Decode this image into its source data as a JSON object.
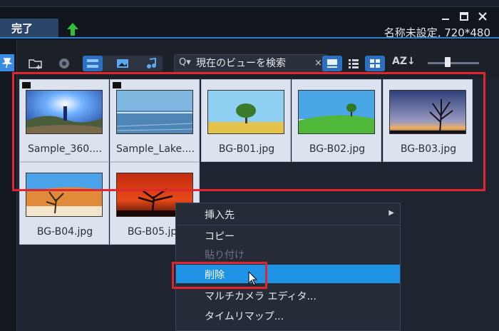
{
  "window": {
    "done_label": "完了",
    "project_info": "名称未設定, 720*480",
    "minimize_glyph": "—",
    "maximize_glyph": "■",
    "close_glyph": "✕"
  },
  "toolbar": {
    "search_placeholder": "現在のビューを検索",
    "search_icon": "Q▾",
    "clear_glyph": "×",
    "sort_label": "AZ↓",
    "view_buttons": [
      "grid-large-view",
      "list-view",
      "grid-small-view"
    ],
    "media_filters": [
      "video-filter",
      "image-filter",
      "audio-filter"
    ]
  },
  "library": {
    "items": [
      {
        "name": "Sample_360....",
        "type": "video"
      },
      {
        "name": "Sample_Lake....",
        "type": "video"
      },
      {
        "name": "BG-B01.jpg",
        "type": "image"
      },
      {
        "name": "BG-B02.jpg",
        "type": "image"
      },
      {
        "name": "BG-B03.jpg",
        "type": "image"
      },
      {
        "name": "BG-B04.jpg",
        "type": "image"
      },
      {
        "name": "BG-B05.jpg",
        "type": "image"
      }
    ]
  },
  "context_menu": {
    "items": [
      {
        "label": "挿入先",
        "submenu": true,
        "enabled": true
      },
      {
        "label": "コピー",
        "enabled": true
      },
      {
        "label": "貼り付け",
        "enabled": false
      },
      {
        "label": "削除",
        "enabled": true,
        "highlighted": true
      },
      {
        "label": "マルチカメラ エディタ...",
        "enabled": true
      },
      {
        "label": "タイムリマップ...",
        "enabled": true
      }
    ],
    "submenu_arrow": "▶"
  },
  "colors": {
    "accent": "#2f7fd0",
    "highlight": "#1f94e6",
    "annotation_red": "#e0262e"
  }
}
